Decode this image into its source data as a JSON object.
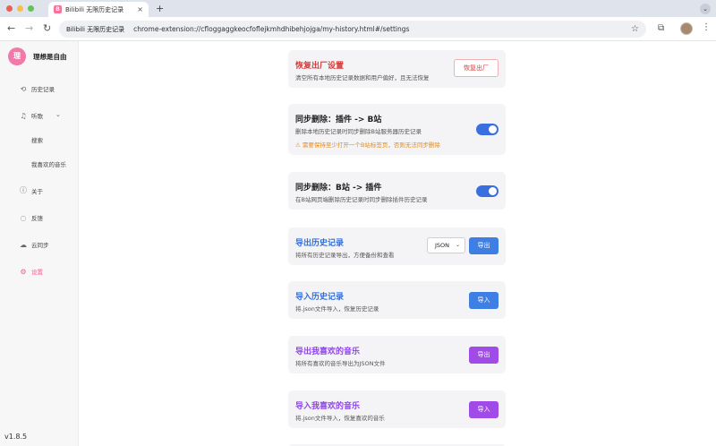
{
  "browser": {
    "tab_title": "Bilibili 无限历史记录",
    "tab_favicon": "B",
    "tab_close": "×",
    "new_tab": "+",
    "tabstrip_menu": "⌄",
    "nav_back": "←",
    "nav_forward": "→",
    "nav_reload": "↻",
    "ext_chip": "Bilibili 无限历史记录",
    "url": "chrome-extension://cfloggaggkeocfoflejkmhdhibehjojga/my-history.html#/settings",
    "star": "☆",
    "ext_icon": "⧉",
    "menu_icon": "⋮"
  },
  "sidebar": {
    "user_initial": "理",
    "user_name": "理想是自由",
    "items": [
      {
        "icon": "⟲",
        "label": "历史记录"
      },
      {
        "icon": "♫",
        "label": "听歌"
      },
      {
        "icon": "ⓘ",
        "label": "关于"
      },
      {
        "icon": "◌",
        "label": "反馈"
      },
      {
        "icon": "☁",
        "label": "云同步"
      },
      {
        "icon": "⚙",
        "label": "设置"
      }
    ],
    "sub_items": [
      "搜索",
      "我喜欢的音乐"
    ],
    "listen_caret": "⌄",
    "version": "v1.8.5"
  },
  "settings": {
    "reset": {
      "title": "恢复出厂设置",
      "desc": "清空所有本地历史记录数据和用户偏好，且无法恢复",
      "button": "恢复出厂"
    },
    "sync_to_bili": {
      "title": "同步删除：插件 -> B站",
      "desc": "删除本地历史记录时同步删除B站服务器历史记录",
      "warning": "⚠ 需要保持至少打开一个B站标签页，否则无法同步删除",
      "enabled": true
    },
    "sync_from_bili": {
      "title": "同步删除：B站 -> 插件",
      "desc": "在B站网页端删除历史记录时同步删除插件历史记录",
      "enabled": true
    },
    "export_history": {
      "title": "导出历史记录",
      "desc": "将所有历史记录导出，方便备份和查看",
      "format": "JSON",
      "format_caret": "⌄",
      "button": "导出"
    },
    "import_history": {
      "title": "导入历史记录",
      "desc": "将.json文件导入，恢复历史记录",
      "button": "导入"
    },
    "export_music": {
      "title": "导出我喜欢的音乐",
      "desc": "将所有喜欢的音乐导出为JSON文件",
      "button": "导出"
    },
    "import_music": {
      "title": "导入我喜欢的音乐",
      "desc": "将.json文件导入，恢复喜欢的音乐",
      "button": "导入"
    }
  },
  "colors": {
    "accent_pink": "#f25d8e",
    "danger": "#d83b3b",
    "primary": "#3f7fe4",
    "purple": "#a04be8"
  }
}
